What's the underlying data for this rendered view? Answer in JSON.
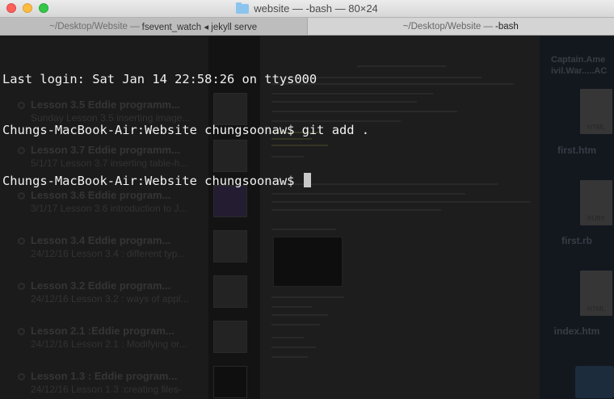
{
  "window": {
    "title": "website — -bash — 80×24"
  },
  "tabs": [
    {
      "path": "~/Desktop/Website — ",
      "process": "fsevent_watch ◂ jekyll serve",
      "active": false
    },
    {
      "path": "~/Desktop/Website — ",
      "process": "-bash",
      "active": true
    }
  ],
  "terminal": {
    "lines": [
      "Last login: Sat Jan 14 22:58:26 on ttys000",
      "Chungs-MacBook-Air:Website chungsoonaw$ git add .",
      "Chungs-MacBook-Air:Website chungsoonaw$ "
    ]
  },
  "background_window": {
    "list_items": [
      {
        "title": "Lesson 3.5 Eddie programm...",
        "subtitle": "Sunday   Lesson 3.5 inserting image..."
      },
      {
        "title": "Lesson 3.7 Eddie programm...",
        "subtitle": "5/1/17   Lesson 3.7 inserting table-h..."
      },
      {
        "title": "Lesson 3.6 Eddie program...",
        "subtitle": "3/1/17   Lesson 3.6 introduction to J..."
      },
      {
        "title": "Lesson 3.4 Eddie program...",
        "subtitle": "24/12/16   Lesson 3.4 : different typ..."
      },
      {
        "title": "Lesson 3.2 Eddie program...",
        "subtitle": "24/12/16   Lesson 3.2 : ways of appl..."
      },
      {
        "title": "Lesson 2.1 :Eddie program...",
        "subtitle": "24/12/16   Lesson 2.1 : Modifying or..."
      },
      {
        "title": "Lesson 1.3 : Eddie program...",
        "subtitle": "24/12/16   Lesson 1.3 :creating files-"
      }
    ]
  },
  "desktop": {
    "top_label": "Captain.Ame\nivil.War.....AC",
    "files": [
      {
        "type": "HTML",
        "name": "first.htm"
      },
      {
        "type": "RUBY",
        "name": "first.rb"
      },
      {
        "type": "HTML",
        "name": "index.htm"
      }
    ]
  }
}
